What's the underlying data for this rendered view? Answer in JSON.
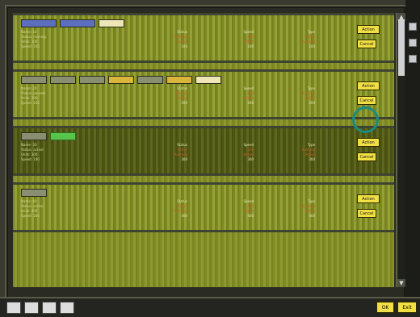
{
  "ui": {
    "buttons": {
      "panel_button_top": "Action",
      "panel_button_bottom": "Cancel",
      "bottom_left": "OK",
      "bottom_right": "Exit"
    },
    "scroll": {
      "up": "▲",
      "down": "▼"
    },
    "icons": [
      "bookmark-icon",
      "map-icon",
      "person-icon",
      "box-icon"
    ]
  },
  "panels": [
    {
      "tags": [
        "",
        "",
        ""
      ],
      "info": [
        "Name: 10",
        "Status: running",
        "Units: 100",
        "Speed: 100"
      ],
      "columns": [
        [
          "Status",
          "Running",
          "Active",
          "100"
        ],
        [
          "Speed",
          "100",
          "Active",
          "100"
        ],
        [
          "Type",
          "Active",
          "Running",
          "100"
        ]
      ]
    },
    {
      "tags": [
        "",
        "",
        "",
        "",
        "",
        "",
        ""
      ],
      "info": [
        "Name: 20",
        "Status: paused",
        "Units: 200",
        "Speed: 100"
      ],
      "columns": [
        [
          "Status",
          "Paused",
          "Active",
          "200"
        ],
        [
          "Speed",
          "100",
          "Active",
          "200"
        ],
        [
          "Type",
          "Running",
          "Active",
          "200"
        ]
      ]
    },
    {
      "tags": [
        "",
        ""
      ],
      "info": [
        "Name: 30",
        "Status: active",
        "Units: 300",
        "Speed: 100"
      ],
      "columns": [
        [
          "Status",
          "Active",
          "Running",
          "300"
        ],
        [
          "Speed",
          "100",
          "Active",
          "300"
        ],
        [
          "Type",
          "Running",
          "Active",
          "300"
        ]
      ]
    },
    {
      "tags": [
        ""
      ],
      "info": [
        "Name: 40",
        "Status: active",
        "Units: 400",
        "Speed: 100"
      ],
      "columns": [
        [
          "Status",
          "Active",
          "Running",
          "400"
        ],
        [
          "Speed",
          "100",
          "Active",
          "400"
        ],
        [
          "Type",
          "Running",
          "Active",
          "400"
        ]
      ]
    }
  ]
}
